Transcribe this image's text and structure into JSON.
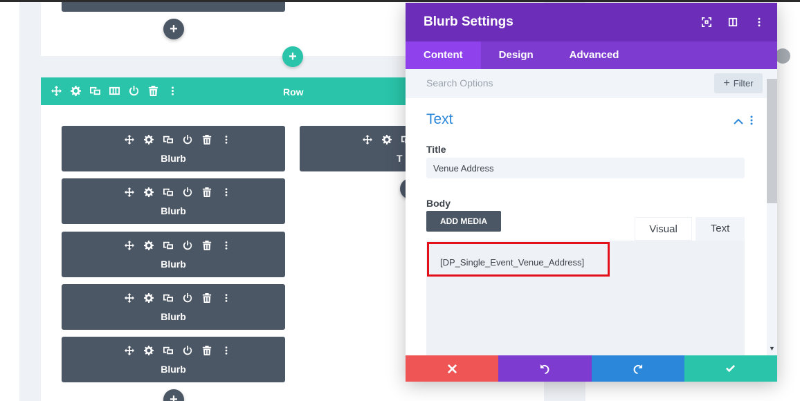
{
  "row": {
    "label": "Row",
    "blurbs": [
      "Blurb",
      "Blurb",
      "Blurb",
      "Blurb",
      "Blurb"
    ],
    "second_column_module_label": "T"
  },
  "panel": {
    "title": "Blurb Settings",
    "tabs": [
      "Content",
      "Design",
      "Advanced"
    ],
    "active_tab": "Content",
    "search_placeholder": "Search Options",
    "filter_label": "Filter",
    "section_title": "Text",
    "title_label": "Title",
    "title_value": "Venue Address",
    "body_label": "Body",
    "add_media_label": "ADD MEDIA",
    "editor_tabs": [
      "Visual",
      "Text"
    ],
    "body_content": "[DP_Single_Event_Venue_Address]"
  },
  "colors": {
    "row_bar": "#29c4a9",
    "module": "#4c5766",
    "panel_header": "#6c2eb9",
    "panel_tabs": "#7e3bd0",
    "highlight": "#e3101a",
    "cancel": "#ef5555",
    "undo": "#7e3bd0",
    "redo": "#2b87da",
    "save": "#29c4a9"
  }
}
